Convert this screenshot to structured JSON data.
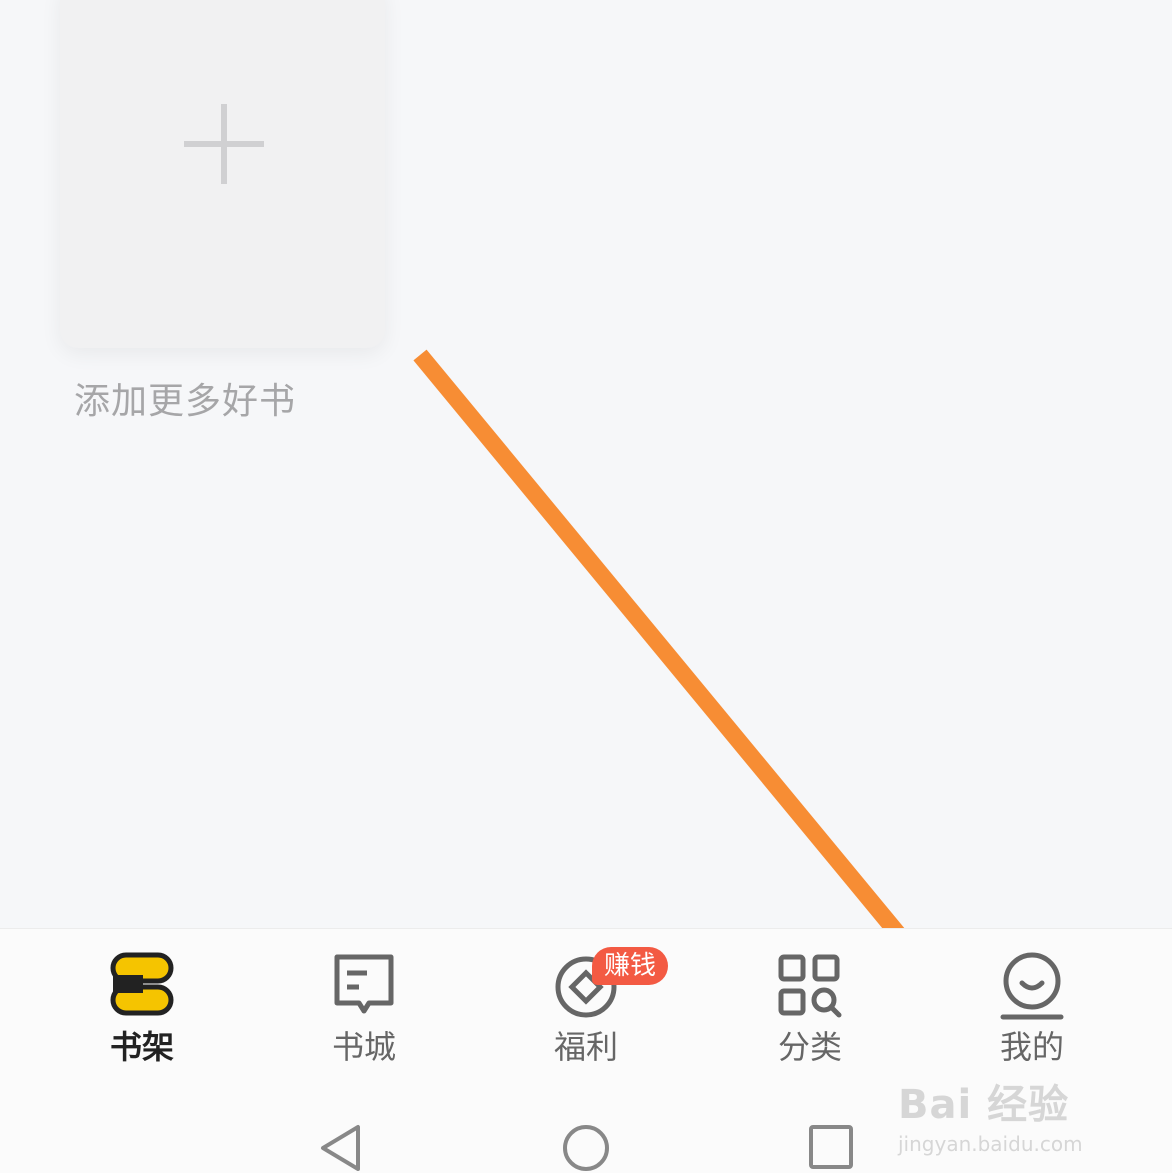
{
  "bookshelf": {
    "add_more_label": "添加更多好书"
  },
  "tabbar": {
    "tabs": [
      {
        "label": "书架",
        "icon": "bookshelf-icon",
        "active": true
      },
      {
        "label": "书城",
        "icon": "bookstore-icon",
        "active": false
      },
      {
        "label": "福利",
        "icon": "coin-icon",
        "active": false,
        "badge": "赚钱"
      },
      {
        "label": "分类",
        "icon": "category-icon",
        "active": false
      },
      {
        "label": "我的",
        "icon": "smile-profile-icon",
        "active": false
      }
    ]
  },
  "system_nav": {
    "buttons": [
      "back-triangle-icon",
      "home-circle-icon",
      "recents-square-icon"
    ]
  },
  "watermark": {
    "brand": "Bai 经验",
    "url": "jingyan.baidu.com"
  },
  "colors": {
    "accent_yellow": "#f5c400",
    "badge_red": "#f35a43",
    "arrow_orange": "#f78d34"
  }
}
